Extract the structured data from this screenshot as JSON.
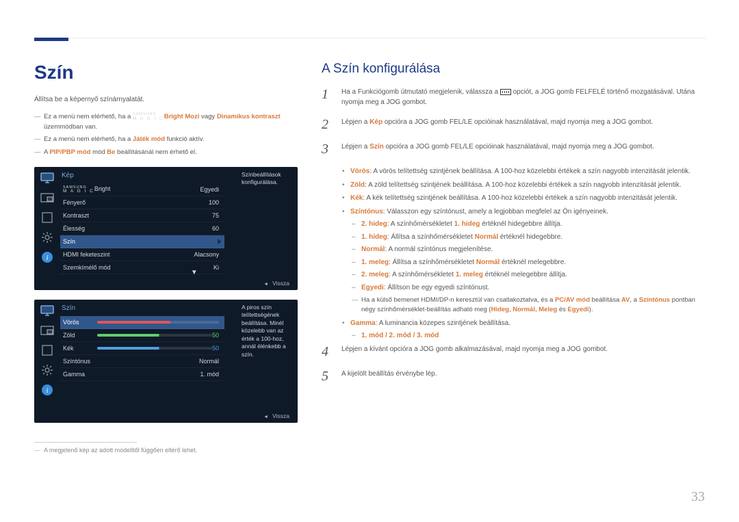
{
  "page": {
    "number": "33"
  },
  "left": {
    "heading": "Szín",
    "intro": "Állítsa be a képernyő színárnyalatát.",
    "notes": [
      {
        "pre": "Ez a menü nem elérhető, ha a ",
        "brand_sam": "SAMSUNG",
        "brand_mag": "M A G I C",
        "brand_tail": "Bright",
        "mode": " Mozi",
        "mid": " vagy ",
        "mode2": "Dinamikus kontraszt",
        "post": " üzemmódban van."
      },
      {
        "pre": "Ez a menü nem elérhető, ha a ",
        "mode": "Játék mód",
        "post": " funkció aktív."
      },
      {
        "pre": "A ",
        "mode": "PIP/PBP mód",
        "mid": " mód ",
        "mode2": "Be",
        "post": " beállításánál nem érhető el."
      }
    ],
    "imgDisclaimer": "A megjelenő kép az adott modelltől függően eltérő lehet."
  },
  "osd1": {
    "title": "Kép",
    "hint": "Színbeállítások konfigurálása.",
    "footer": "Vissza",
    "brightLabel": "Bright",
    "brightValue": "Egyedi",
    "sam": "SAMSUNG",
    "mag": "M A G I C",
    "rows": [
      {
        "label": "Fényerő",
        "value": "100"
      },
      {
        "label": "Kontraszt",
        "value": "75"
      },
      {
        "label": "Élesség",
        "value": "60"
      },
      {
        "label": "Szín",
        "value": "",
        "selected": true
      },
      {
        "label": "HDMI feketeszint",
        "value": "Alacsony"
      },
      {
        "label": "Szemkímélő mód",
        "value": "Ki"
      }
    ]
  },
  "osd2": {
    "title": "Szín",
    "hint": "A piros szín telítettségének beállítása. Minél közelebb van az érték a 100-hoz, annál élénkebb a szín.",
    "footer": "Vissza",
    "rows": {
      "red": {
        "label": "Vörös",
        "value": ""
      },
      "green": {
        "label": "Zöld",
        "value": "50"
      },
      "blue": {
        "label": "Kék",
        "value": "50"
      },
      "tone": {
        "label": "Színtónus",
        "value": "Normál"
      },
      "gamma": {
        "label": "Gamma",
        "value": "1. mód"
      }
    }
  },
  "right": {
    "heading": "A Szín konfigurálása",
    "steps": {
      "1": {
        "pre": "Ha a Funkciógomb útmutató megjelenik, válassza a ",
        "post": " opciót, a JOG gomb FELFELÉ történő mozgatásával. Utána nyomja meg a JOG gombot."
      },
      "2": {
        "pre": "Lépjen a ",
        "kw": "Kép",
        "post": " opcióra a JOG gomb FEL/LE opcióinak használatával, majd nyomja meg a JOG gombot."
      },
      "3": {
        "pre": "Lépjen a ",
        "kw": "Szín",
        "post": " opcióra a JOG gomb FEL/LE opcióinak használatával, majd nyomja meg a JOG gombot."
      },
      "4": "Lépjen a kívánt opcióra a JOG gomb alkalmazásával, majd nyomja meg a JOG gombot.",
      "5": "A kijelölt beállítás érvénybe lép."
    },
    "bullets": {
      "red": {
        "kw": "Vörös",
        "txt": ": A vörös telítettség szintjének beállítása. A 100-hoz közelebbi értékek a szín nagyobb intenzitását jelentik."
      },
      "green": {
        "kw": "Zöld",
        "txt": ": A zöld telítettség szintjének beállítása. A 100-hoz közelebbi értékek a szín nagyobb intenzitását jelentik."
      },
      "blue": {
        "kw": "Kék",
        "txt": ": A kék telítettség szintjének beállítása. A 100-hoz közelebbi értékek a szín nagyobb intenzitását jelentik."
      },
      "tone": {
        "kw": "Színtónus",
        "txt": ": Válasszon egy színtónust, amely a legjobban megfelel az Ön igényeinek."
      }
    },
    "sub": {
      "cool2": {
        "kw": "2. hideg",
        "pre": ": A színhőmérsékletet ",
        "kw2": "1. hideg",
        "post": " értéknél hidegebbre állítja."
      },
      "cool1": {
        "kw": "1. hideg",
        "pre": ": Állítsa a színhőmérsékletet ",
        "kw2": "Normál",
        "post": " értéknél hidegebbre."
      },
      "normal": {
        "kw": "Normál",
        "post": ": A normál színtónus megjelenítése."
      },
      "warm1": {
        "kw": "1. meleg",
        "pre": ": Állítsa a színhőmérsékletet ",
        "kw2": "Normál",
        "post": " értéknél melegebbre."
      },
      "warm2": {
        "kw": "2. meleg",
        "pre": ": A színhőmérsékletet ",
        "kw2": "1. meleg",
        "post": " értéknél melegebbre állítja."
      },
      "custom": {
        "kw": "Egyedi",
        "post": ": Állítson be egy egyedi színtónust."
      }
    },
    "subnote": {
      "pre": "Ha a külső bemenet HDMI/DP-n keresztül van csatlakoztatva, és a ",
      "kw": "PC/AV mód",
      "mid": " beállítása ",
      "kw2": "AV",
      "mid2": ", a ",
      "kw3": "Színtónus",
      "post": " pontban négy színhőmérséklet-beállítás adható meg (",
      "a": "Hideg",
      "b": "Normál",
      "c": "Meleg",
      "d": "Egyedi",
      "close": ")."
    },
    "gamma": {
      "kw": "Gamma",
      "txt": ": A luminancia közepes szintjének beállítása.",
      "modes": "1. mód / 2. mód / 3. mód"
    }
  }
}
